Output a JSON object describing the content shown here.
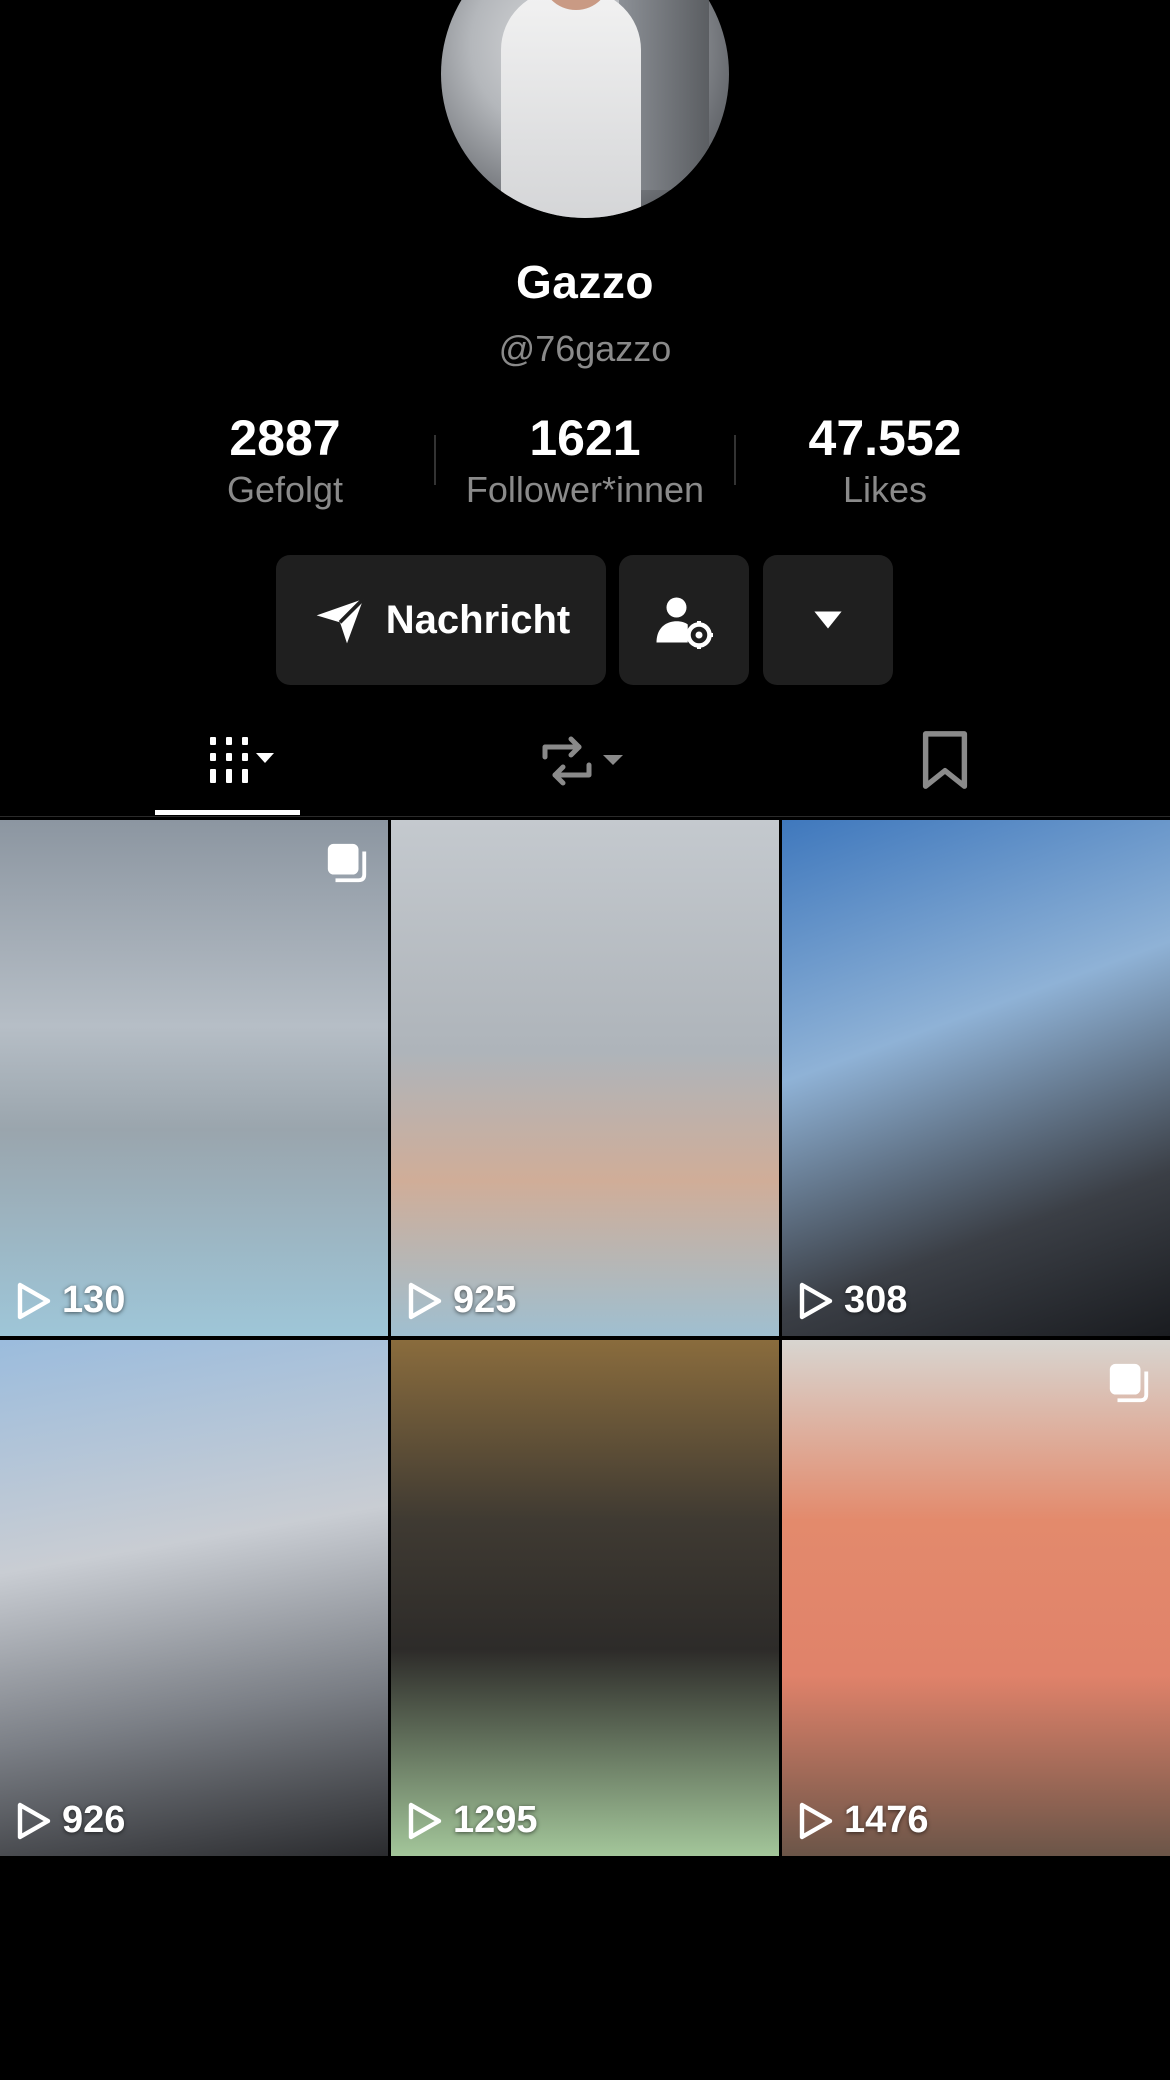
{
  "profile": {
    "display_name": "Gazzo",
    "handle": "@76gazzo"
  },
  "stats": {
    "following": {
      "value": "2887",
      "label": "Gefolgt"
    },
    "followers": {
      "value": "1621",
      "label": "Follower*innen"
    },
    "likes": {
      "value": "47.552",
      "label": "Likes"
    }
  },
  "actions": {
    "message_label": "Nachricht"
  },
  "tabs": [
    "videos-grid-icon",
    "repost-icon",
    "bookmark-icon"
  ],
  "videos": [
    {
      "views": "130",
      "multi": true
    },
    {
      "views": "925",
      "multi": false
    },
    {
      "views": "308",
      "multi": false
    },
    {
      "views": "926",
      "multi": false
    },
    {
      "views": "1295",
      "multi": false
    },
    {
      "views": "1476",
      "multi": true
    }
  ],
  "colors": {
    "background": "#000000",
    "button_bg": "#1f1f1f",
    "muted_text": "#8a8a8a"
  }
}
